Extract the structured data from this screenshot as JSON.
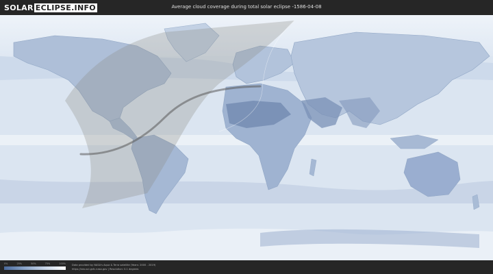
{
  "header": {
    "logo_part1": "SOLAR",
    "logo_part2": "ECLIPSE.INFO",
    "title": "Average cloud coverage during total solar eclipse -1586-04-08"
  },
  "legend": {
    "ticks": [
      "0%",
      "25%",
      "50%",
      "75%",
      "100%"
    ],
    "colors": [
      "#4a6a9c",
      "#8aa4c8",
      "#c9d6e8",
      "#ffffff"
    ]
  },
  "footer": {
    "data_source": "Data provided by NASA's Aqua & Terra satellite (Years: 2000 - 2019)",
    "url_resolution": "https://neo.sci.gsfc.nasa.gov | Resolution: 0.1 degrees"
  },
  "colors": {
    "map_background": "#dfe8f3",
    "land": "#a9bcd6",
    "dense_cloud": "#6e88b2",
    "eclipse_band": "#8c8a86",
    "centerline": "#5a5a5a"
  }
}
